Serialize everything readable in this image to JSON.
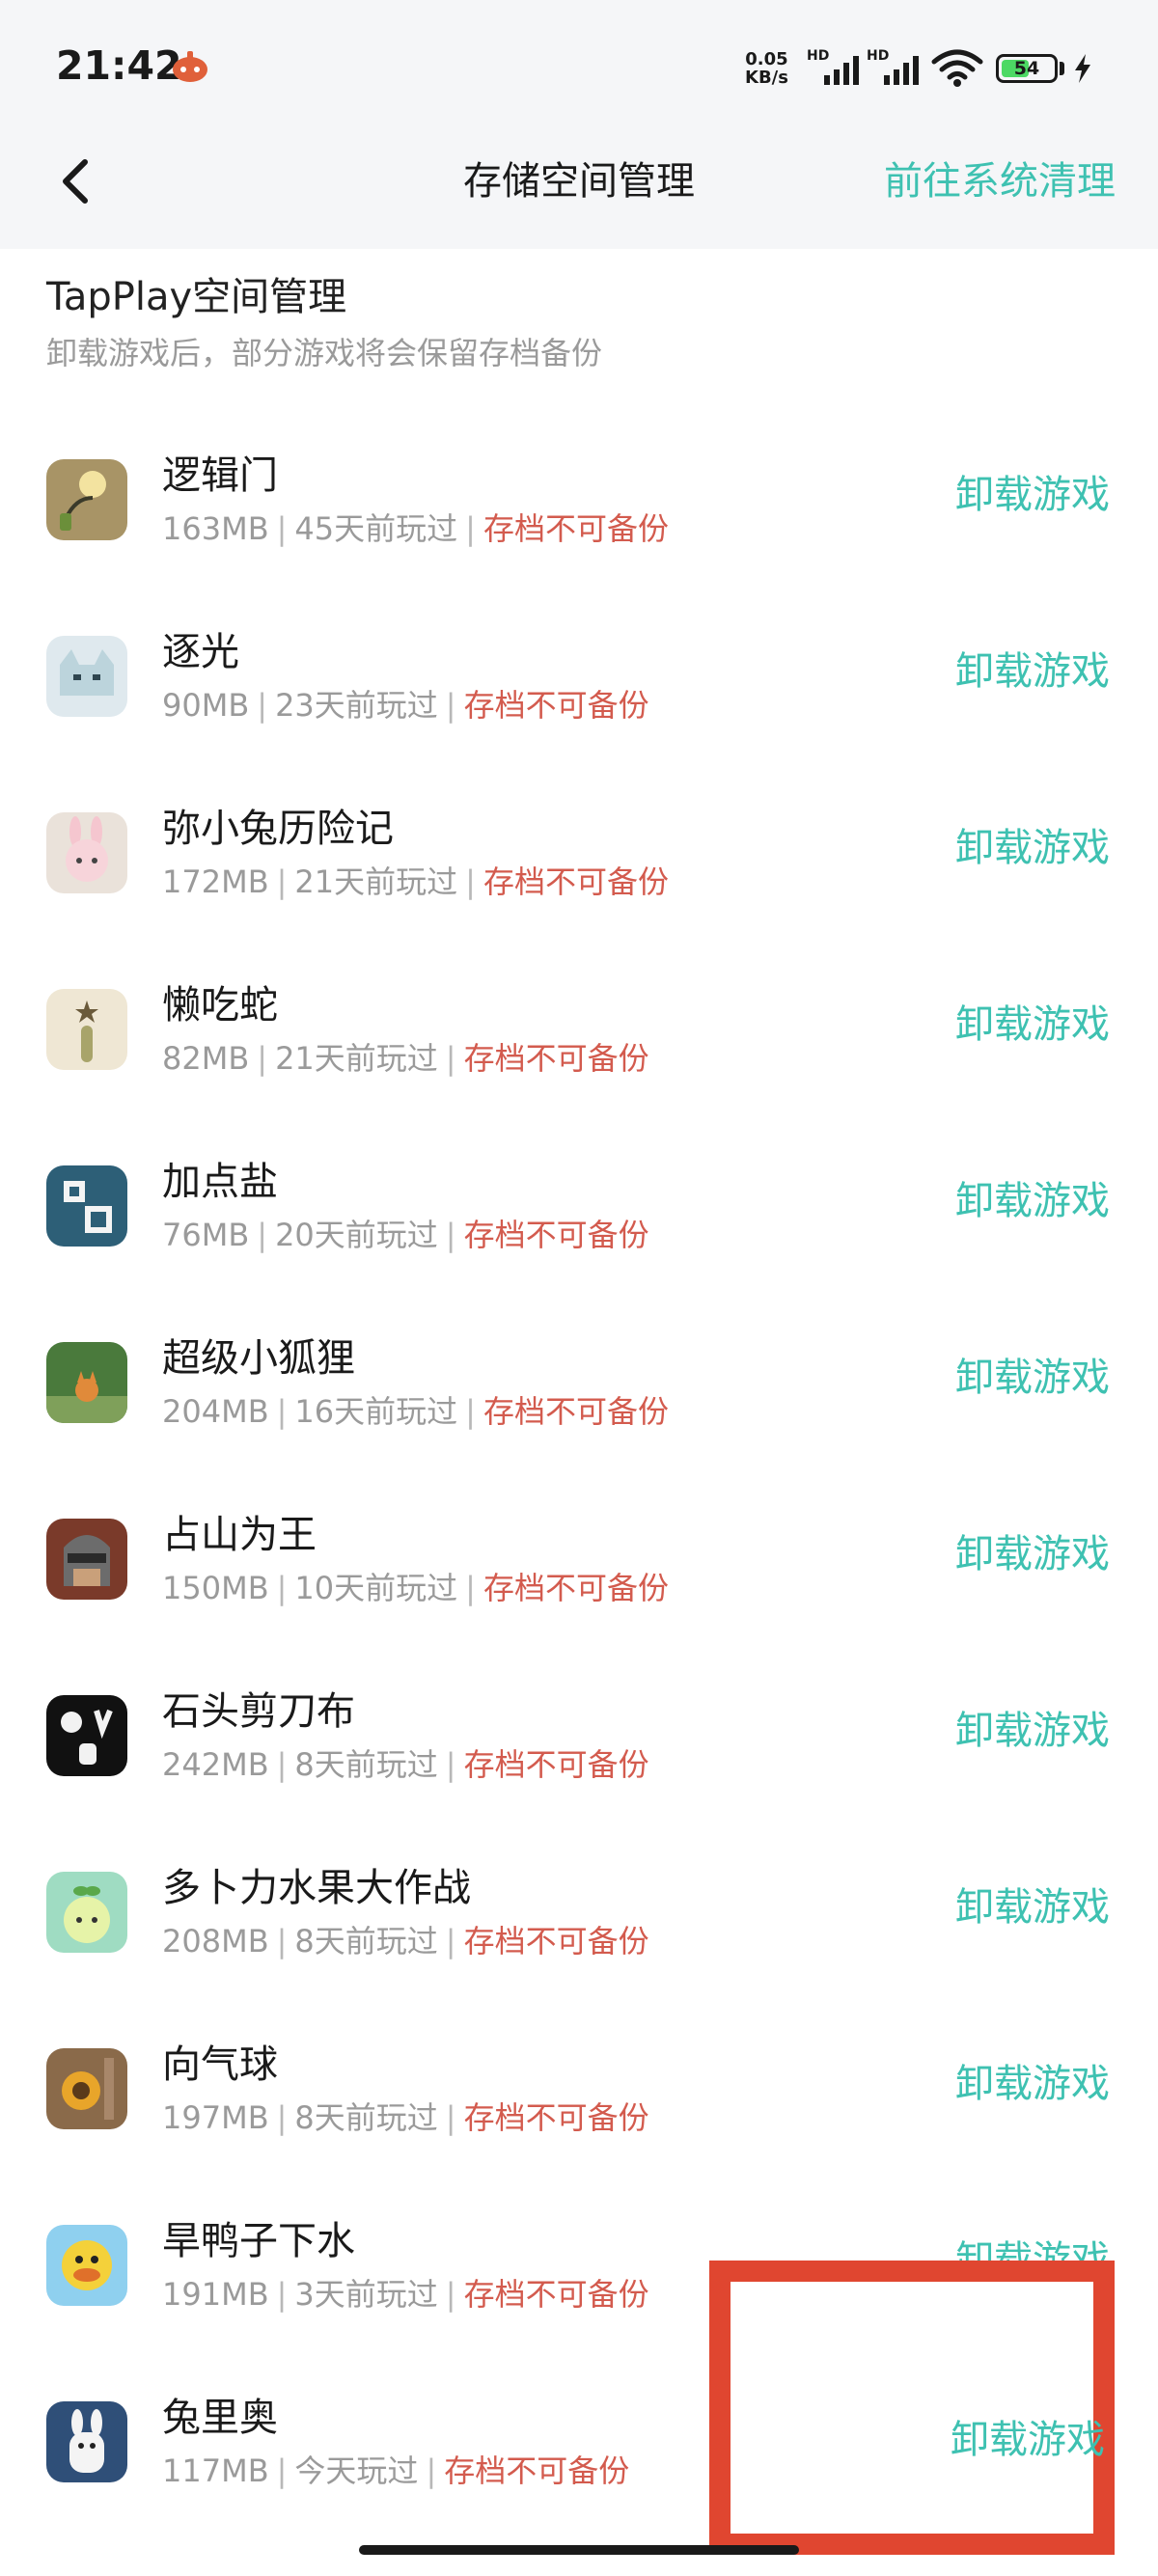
{
  "status_bar": {
    "time": "21:42",
    "net_speed_value": "0.05",
    "net_speed_unit": "KB/s",
    "sim1_label": "HD",
    "sim2_label": "HD",
    "battery": "54",
    "battery_level": 0.54,
    "icons": [
      "notification-app-icon",
      "signal-icon",
      "wifi-icon",
      "battery-icon",
      "charging-bolt-icon"
    ]
  },
  "header": {
    "back_icon": "chevron-left-icon",
    "title": "存储空间管理",
    "action": "前往系统清理"
  },
  "section": {
    "title": "TapPlay空间管理",
    "subtitle": "卸载游戏后，部分游戏将会保留存档备份"
  },
  "games": [
    {
      "name": "逻辑门",
      "size": "163MB",
      "last_played": "45天前玩过",
      "backup": "存档不可备份",
      "action": "卸载游戏"
    },
    {
      "name": "逐光",
      "size": "90MB",
      "last_played": "23天前玩过",
      "backup": "存档不可备份",
      "action": "卸载游戏"
    },
    {
      "name": "弥小兔历险记",
      "size": "172MB",
      "last_played": "21天前玩过",
      "backup": "存档不可备份",
      "action": "卸载游戏"
    },
    {
      "name": "懒吃蛇",
      "size": "82MB",
      "last_played": "21天前玩过",
      "backup": "存档不可备份",
      "action": "卸载游戏"
    },
    {
      "name": "加点盐",
      "size": "76MB",
      "last_played": "20天前玩过",
      "backup": "存档不可备份",
      "action": "卸载游戏"
    },
    {
      "name": "超级小狐狸",
      "size": "204MB",
      "last_played": "16天前玩过",
      "backup": "存档不可备份",
      "action": "卸载游戏"
    },
    {
      "name": "占山为王",
      "size": "150MB",
      "last_played": "10天前玩过",
      "backup": "存档不可备份",
      "action": "卸载游戏"
    },
    {
      "name": "石头剪刀布",
      "size": "242MB",
      "last_played": "8天前玩过",
      "backup": "存档不可备份",
      "action": "卸载游戏"
    },
    {
      "name": "多卜力水果大作战",
      "size": "208MB",
      "last_played": "8天前玩过",
      "backup": "存档不可备份",
      "action": "卸载游戏"
    },
    {
      "name": "向气球",
      "size": "197MB",
      "last_played": "8天前玩过",
      "backup": "存档不可备份",
      "action": "卸载游戏"
    },
    {
      "name": "旱鸭子下水",
      "size": "191MB",
      "last_played": "3天前玩过",
      "backup": "存档不可备份",
      "action": "卸载游戏"
    },
    {
      "name": "兔里奥",
      "size": "117MB",
      "last_played": "今天玩过",
      "backup": "存档不可备份",
      "action": "卸载游戏"
    }
  ],
  "colors": {
    "accent": "#3ec1b1",
    "warning": "#d35b4e",
    "highlight_box": "#e04630",
    "topbar_bg": "#f5f6f8"
  }
}
